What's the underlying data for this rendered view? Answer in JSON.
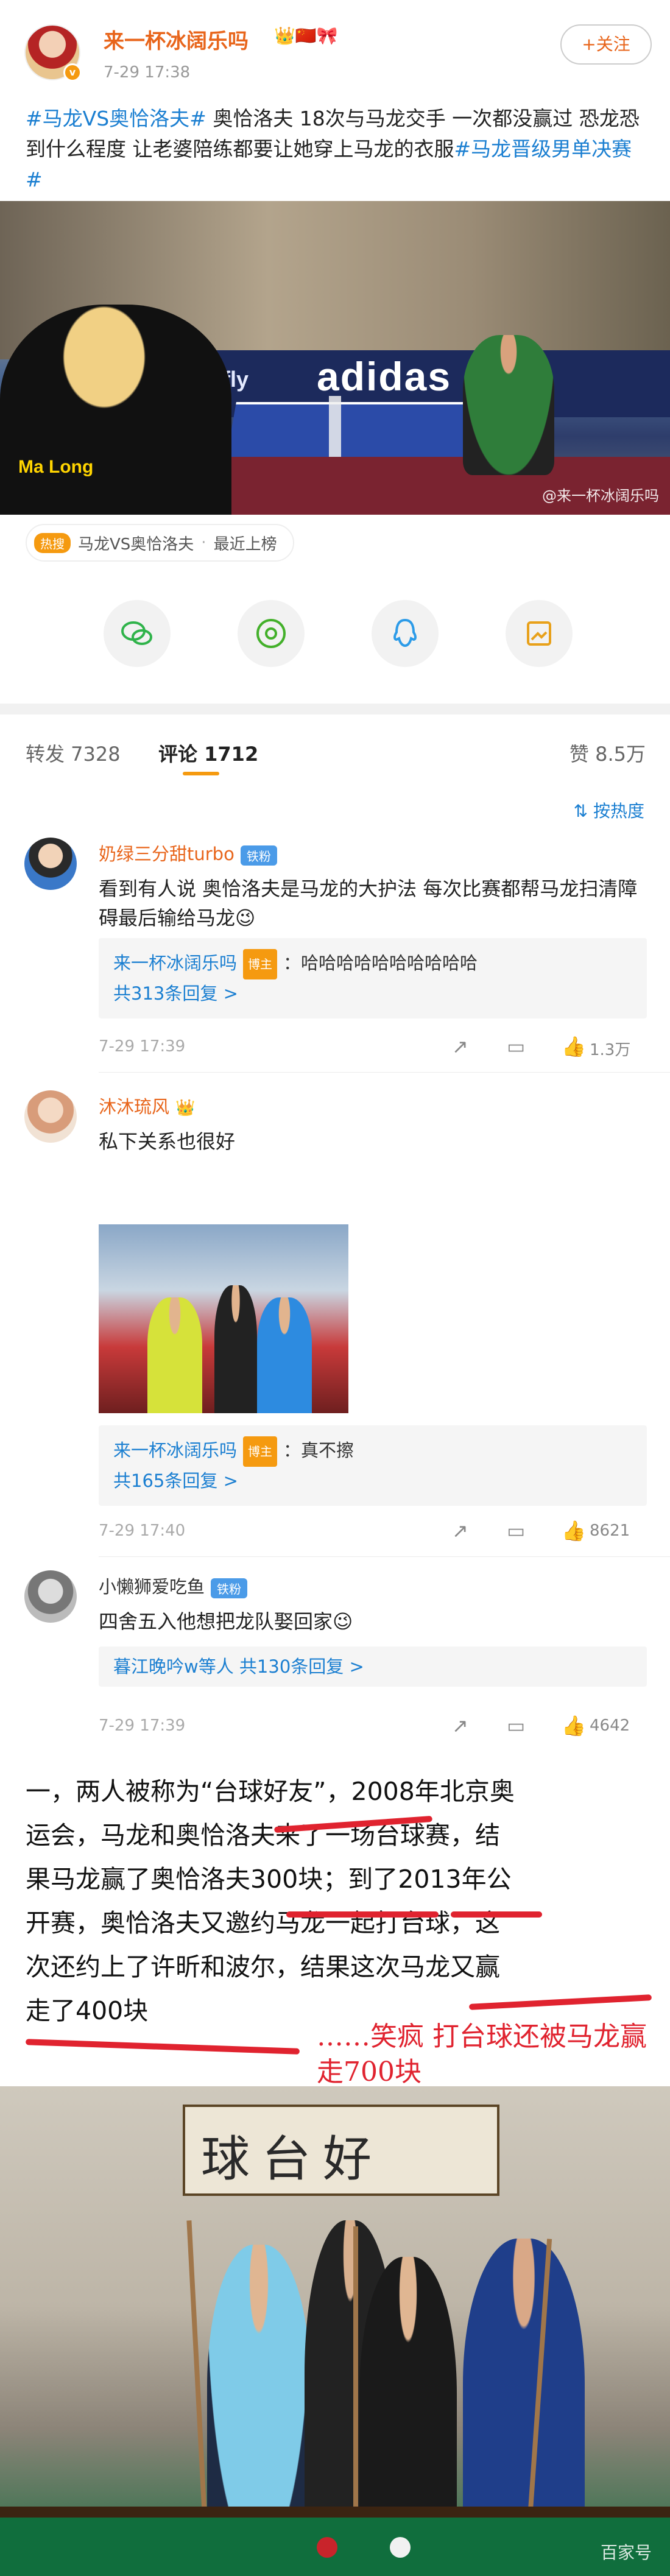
{
  "post": {
    "author": "来一杯冰阔乐吗",
    "author_badges": "👑🇨🇳🎀",
    "time": "7-29 17:38",
    "follow_label": "+关注",
    "text_parts": [
      {
        "type": "tag",
        "text": "#马龙VS奥恰洛夫#"
      },
      {
        "type": "text",
        "text": " 奥恰洛夫 18次与马龙交手 一次都没赢过 恐龙恐到什么程度 让老婆陪练都要让她穿上马龙的衣服"
      },
      {
        "type": "tag",
        "text": "#马龙晋级男单决赛#"
      }
    ],
    "photo": {
      "board_text": "adidas",
      "butterfly": "Butterfly",
      "shirt_text": "Ma Long",
      "watermark": "@来一杯冰阔乐吗"
    },
    "topic_chip": {
      "icon_label": "热搜",
      "label": "马龙VS奥恰洛夫",
      "separator": "·",
      "status": "最近上榜"
    }
  },
  "share": {
    "wechat_icon": "wechat-icon",
    "moments_icon": "moments-icon",
    "qq_icon": "qq-icon",
    "save_icon": "save-image-icon"
  },
  "tabs": {
    "repost": "转发 7328",
    "comments": "评论 1712",
    "likes": "赞 8.5万",
    "sort_label": "按热度"
  },
  "comments": [
    {
      "name": "奶绿三分甜turbo",
      "badge": "铁粉",
      "text": "看到有人说 奥恰洛夫是马龙的大护法 每次比赛都帮马龙扫清障碍最后输给马龙😉",
      "reply": {
        "name": "来一杯冰阔乐吗",
        "host": "博主",
        "text": "：哈哈哈哈哈哈哈哈哈哈",
        "more": "共313条回复 >"
      },
      "time": "7-29 17:39",
      "likes": "1.3万"
    },
    {
      "name": "沐沐琉风",
      "badge": "",
      "text": "私下关系也很好",
      "reply": {
        "name": "来一杯冰阔乐吗",
        "host": "博主",
        "text": "：真不擦",
        "more": "共165条回复 >"
      },
      "time": "7-29 17:40",
      "likes": "8621"
    },
    {
      "name": "小懒狮爱吃鱼",
      "badge": "铁粉",
      "text": "四舍五入他想把龙队娶回家😉",
      "reply": {
        "name": "暮江晚吟w等人",
        "host": "",
        "text": " 共130条回复 >",
        "more": ""
      },
      "time": "7-29 17:39",
      "likes": "4642"
    }
  ],
  "article": {
    "lines": [
      "一，两人被称为“台球好友”，2008年北京奥",
      "运会，马龙和奥恰洛夫来了一场台球赛，结",
      "果马龙赢了奥恰洛夫300块；到了2013年公",
      "开赛，奥恰洛夫又邀约马龙一起打台球，这",
      "次还约上了许昕和波尔，结果这次马龙又赢",
      "走了400块"
    ],
    "handwritten": "……笑疯 打台球还被马龙赢走700块",
    "scribble_color": "#e0232f"
  },
  "billiard_photo": {
    "calligraphy": "球台好",
    "watermark": "百家号"
  }
}
